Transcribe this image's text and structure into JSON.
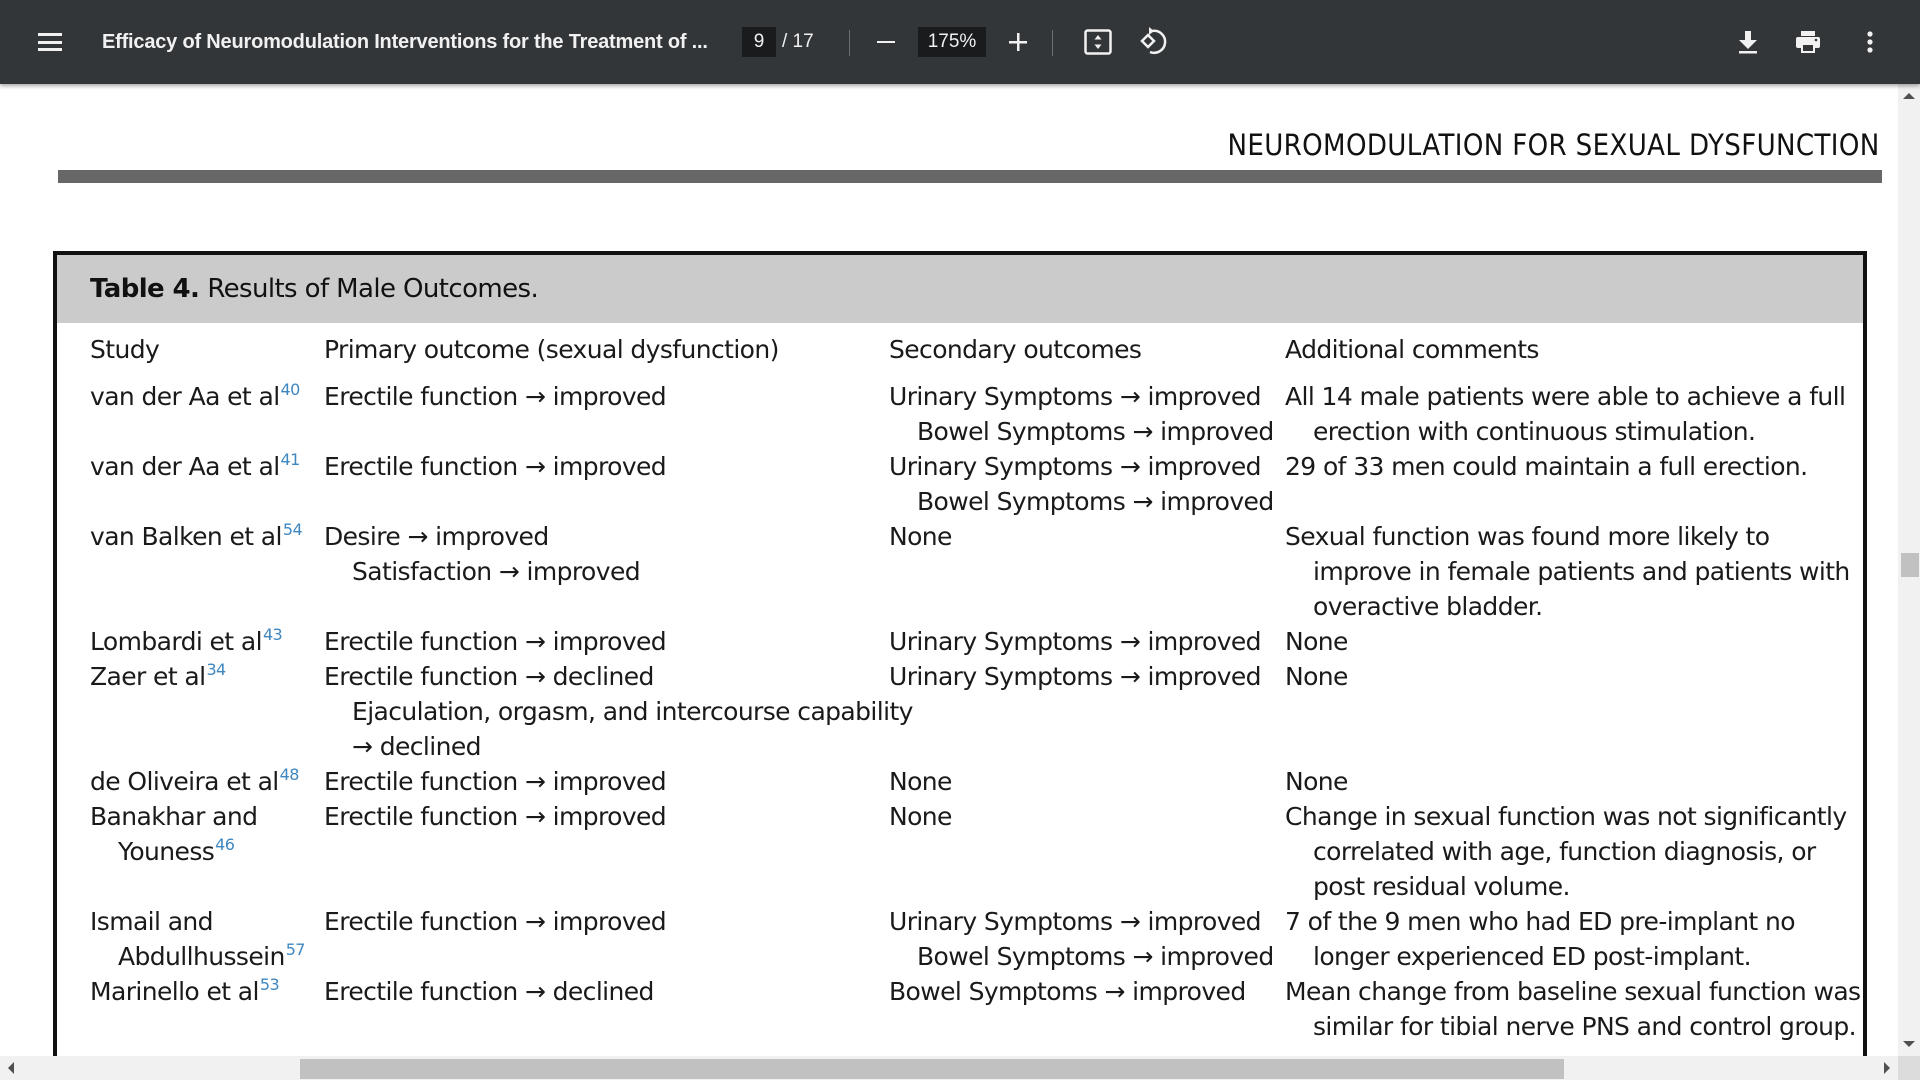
{
  "toolbar": {
    "menu_icon": "hamburger-menu-icon",
    "title": "Efficacy of Neuromodulation Interventions for the Treatment of ...",
    "current_page": "9",
    "total_pages": "/ 17",
    "zoom_out_icon": "minus-icon",
    "zoom_level": "175%",
    "zoom_in_icon": "plus-icon",
    "fit_page_icon": "fit-to-page-icon",
    "rotate_icon": "rotate-counterclockwise-icon",
    "download_icon": "download-icon",
    "print_icon": "print-icon",
    "more_icon": "more-vertical-icon"
  },
  "page": {
    "running_head": "NEUROMODULATION FOR SEXUAL DYSFUNCTION",
    "table": {
      "caption_label": "Table 4.",
      "caption_text": "Results of Male Outcomes.",
      "columns": [
        "Study",
        "Primary outcome (sexual dysfunction)",
        "Secondary outcomes",
        "Additional comments"
      ],
      "rows": [
        {
          "study": [
            "van der Aa et al"
          ],
          "ref": "40",
          "primary": [
            "Erectile function → improved"
          ],
          "secondary": [
            "Urinary Symptoms → improved",
            "Bowel Symptoms → improved"
          ],
          "comments": [
            "All 14 male patients were able to achieve a full",
            "erection with continuous stimulation."
          ]
        },
        {
          "study": [
            "van der Aa et al"
          ],
          "ref": "41",
          "primary": [
            "Erectile function → improved"
          ],
          "secondary": [
            "Urinary Symptoms → improved",
            "Bowel Symptoms → improved"
          ],
          "comments": [
            "29 of 33 men could maintain a full erection."
          ]
        },
        {
          "study": [
            "van Balken et al"
          ],
          "ref": "54",
          "primary": [
            "Desire → improved",
            "Satisfaction → improved"
          ],
          "secondary": [
            "None"
          ],
          "comments": [
            "Sexual function was found more likely to",
            "improve in female patients and patients with",
            "overactive bladder."
          ]
        },
        {
          "study": [
            "Lombardi et al"
          ],
          "ref": "43",
          "primary": [
            "Erectile function → improved"
          ],
          "secondary": [
            "Urinary Symptoms → improved"
          ],
          "comments": [
            "None"
          ]
        },
        {
          "study": [
            "Zaer et al"
          ],
          "ref": "34",
          "primary": [
            "Erectile function → declined",
            "Ejaculation, orgasm, and intercourse capability",
            "→ declined"
          ],
          "secondary": [
            "Urinary Symptoms → improved"
          ],
          "comments": [
            "None"
          ]
        },
        {
          "study": [
            "de Oliveira et al"
          ],
          "ref": "48",
          "primary": [
            "Erectile function → improved"
          ],
          "secondary": [
            "None"
          ],
          "comments": [
            "None"
          ]
        },
        {
          "study": [
            "Banakhar and",
            "Youness"
          ],
          "ref": "46",
          "primary": [
            "Erectile function → improved"
          ],
          "secondary": [
            "None"
          ],
          "comments": [
            "Change in sexual function was not significantly",
            "correlated with age, function diagnosis, or",
            "post residual volume."
          ]
        },
        {
          "study": [
            "Ismail and",
            "Abdullhussein"
          ],
          "ref": "57",
          "primary": [
            "Erectile function → improved"
          ],
          "secondary": [
            "Urinary Symptoms → improved",
            "Bowel Symptoms → improved"
          ],
          "comments": [
            "7 of the 9 men who had ED pre-implant no",
            "longer experienced ED post-implant."
          ]
        },
        {
          "study": [
            "Marinello et al"
          ],
          "ref": "53",
          "primary": [
            "Erectile function → declined"
          ],
          "secondary": [
            "Bowel Symptoms → improved"
          ],
          "comments": [
            "Mean change from baseline sexual function was",
            "similar for tibial nerve PNS and control group."
          ]
        }
      ]
    }
  },
  "colors": {
    "toolbar_bg": "#323639",
    "caption_bg": "#cbcbcb",
    "reference_link": "#3f87c0",
    "rule": "#676767"
  }
}
